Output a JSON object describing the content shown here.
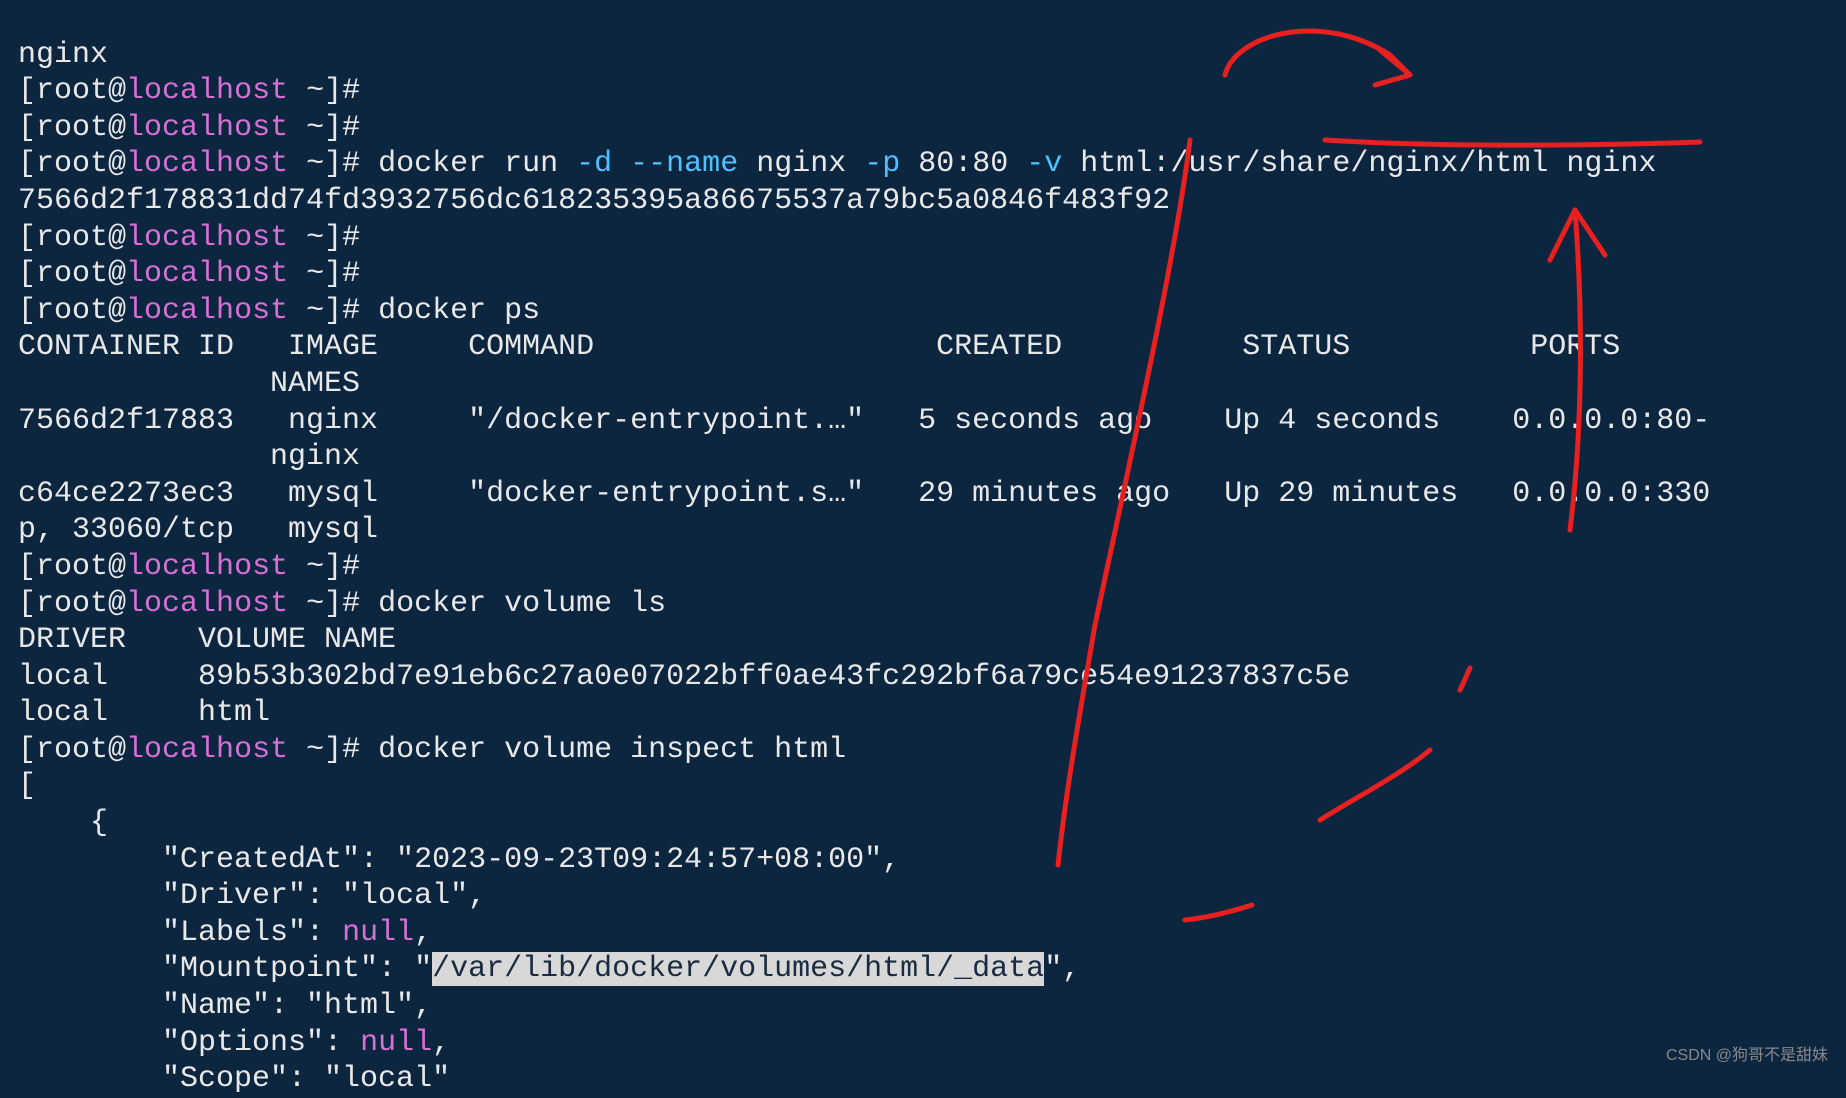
{
  "prompt": {
    "lb": "[",
    "user": "root",
    "at": "@",
    "host": "localhost",
    "path": " ~",
    "rb": "]#"
  },
  "line_top": "nginx",
  "cmd_run": {
    "prefix": " docker run ",
    "flag_d": "-d",
    "flag_name": " --name",
    "arg_name": " nginx ",
    "flag_p": "-p",
    "arg_p": " 80:80 ",
    "flag_v": "-v",
    "arg_v": " html:/usr/share/nginx/html nginx"
  },
  "container_hash": "7566d2f178831dd74fd3932756dc618235395a86675537a79bc5a0846f483f92",
  "cmd_ps": " docker ps",
  "ps_header1": "CONTAINER ID   IMAGE     COMMAND                   CREATED          STATUS          PORTS",
  "ps_header2": "              NAMES",
  "ps_row1a": "7566d2f17883   nginx     \"/docker-entrypoint.…\"   5 seconds ago    Up 4 seconds    0.0.0.0:80-",
  "ps_row1b": "              nginx",
  "ps_row2a": "c64ce2273ec3   mysql     \"docker-entrypoint.s…\"   29 minutes ago   Up 29 minutes   0.0.0.0:330",
  "ps_row2b": "p, 33060/tcp   mysql",
  "cmd_vol_ls": " docker volume ls",
  "vol_header": "DRIVER    VOLUME NAME",
  "vol_row1": "local     89b53b302bd7e91eb6c27a0e07022bff0ae43fc292bf6a79ce54e91237837c5e",
  "vol_row2": "local     html",
  "cmd_vol_inspect": " docker volume inspect html",
  "json_open_bracket": "[",
  "json_open_brace": "    {",
  "json_created": "        \"CreatedAt\": \"2023-09-23T09:24:57+08:00\",",
  "json_driver": "        \"Driver\": \"local\",",
  "json_labels_k": "        \"Labels\": ",
  "json_null": "null",
  "json_comma": ",",
  "json_mount_k": "        \"Mountpoint\": \"",
  "json_mount_hl": "/var/lib/docker/volumes/html/_data",
  "json_mount_tail": "\",",
  "json_name": "        \"Name\": \"html\",",
  "json_options_k": "        \"Options\": ",
  "json_scope": "        \"Scope\": \"local\"",
  "watermark": "CSDN @狗哥不是甜妹"
}
